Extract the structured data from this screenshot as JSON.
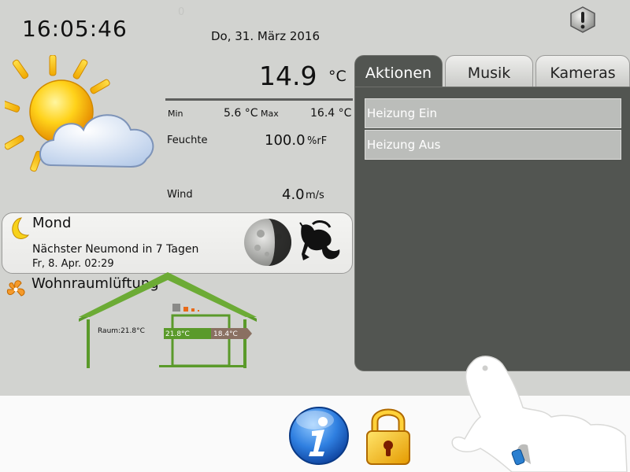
{
  "header": {
    "time": "16:05:46",
    "date": "Do, 31. März 2016",
    "faint_counter": "0"
  },
  "weather": {
    "temperature": "14.9",
    "temperature_unit": "°C",
    "min_label": "Min",
    "min_value": "5.6 °C",
    "max_label": "Max",
    "max_value": "16.4 °C",
    "humidity_label": "Feuchte",
    "humidity_value": "100.0",
    "humidity_unit": "%rF",
    "wind_label": "Wind",
    "wind_value": "4.0",
    "wind_unit": "m/s",
    "icon": "sun-behind-cloud-icon"
  },
  "moon": {
    "title": "Mond",
    "next_new_moon": "Nächster Neumond in 7 Tagen",
    "next_new_moon_date": "Fr, 8. Apr. 02:29",
    "zodiac_icon": "capricorn-icon"
  },
  "ventilation": {
    "title": "Wohnraumlüftung",
    "room_temp": "Raum:21.8°C",
    "supply_temp": "21.8°C",
    "exhaust_temp": "18.4°C"
  },
  "tabs": [
    {
      "label": "Aktionen",
      "active": true
    },
    {
      "label": "Musik",
      "active": false
    },
    {
      "label": "Kameras",
      "active": false
    }
  ],
  "actions": [
    {
      "label": "Heizung Ein"
    },
    {
      "label": "Heizung Aus"
    }
  ],
  "colors": {
    "background": "#d2d3d0",
    "panel_dark": "#525551",
    "house_green": "#5a9a2a",
    "bottom_bar": "#fafafa"
  },
  "icons": {
    "alert": "exclamation-icon",
    "info": "info-icon",
    "lock": "padlock-icon",
    "logo": "gecko-logo"
  }
}
